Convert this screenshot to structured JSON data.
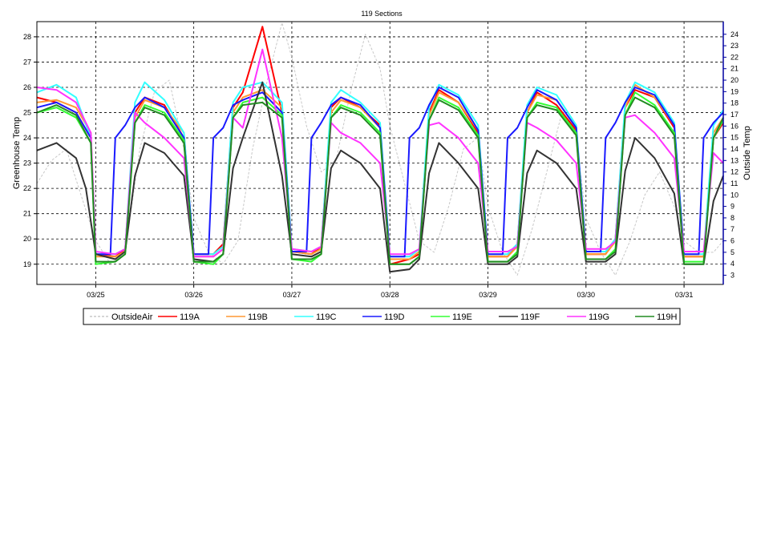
{
  "chart_data": {
    "type": "line",
    "title": "119 Sections",
    "ylabel": "Greenhouse Temp",
    "y2label": "Outside Temp",
    "x_ticks": [
      "03/25",
      "03/26",
      "03/27",
      "03/28",
      "03/29",
      "03/30",
      "03/31"
    ],
    "x_range_days": [
      -0.6,
      6.4
    ],
    "ylim": [
      18.2,
      28.6
    ],
    "y_ticks": [
      19,
      20,
      21,
      22,
      23,
      24,
      25,
      26,
      27,
      28
    ],
    "y2lim": [
      2.2,
      25.1
    ],
    "y2_ticks": [
      3,
      4,
      5,
      6,
      7,
      8,
      9,
      10,
      11,
      12,
      13,
      14,
      15,
      16,
      17,
      18,
      19,
      20,
      21,
      22,
      23,
      24
    ],
    "grid": true,
    "legend_position": "bottom",
    "series": [
      {
        "name": "OutsideAir",
        "axis": "right",
        "color": "#c8c8c8",
        "style": "dashed",
        "x": [
          -0.6,
          -0.45,
          -0.3,
          -0.15,
          0.0,
          0.15,
          0.3,
          0.45,
          0.6,
          0.75,
          0.9,
          1.0,
          1.15,
          1.3,
          1.45,
          1.6,
          1.75,
          1.9,
          2.0,
          2.15,
          2.3,
          2.45,
          2.6,
          2.75,
          2.9,
          3.0,
          3.15,
          3.3,
          3.45,
          3.6,
          3.75,
          3.9,
          4.0,
          4.15,
          4.3,
          4.45,
          4.6,
          4.75,
          4.9,
          5.0,
          5.15,
          5.3,
          5.45,
          5.6,
          5.75,
          5.9,
          6.0,
          6.15,
          6.3,
          6.4
        ],
        "y": [
          11,
          13,
          14,
          10,
          6,
          4,
          5,
          14,
          19,
          20,
          14,
          8,
          5,
          4,
          6,
          14,
          20,
          25,
          22,
          16,
          12,
          13,
          19,
          24,
          21,
          16,
          11,
          6,
          5,
          9,
          14,
          15,
          9,
          5,
          3,
          7,
          12,
          17,
          15,
          8,
          5,
          3,
          6,
          10,
          12,
          9,
          6,
          5,
          5,
          6
        ]
      },
      {
        "name": "119A",
        "axis": "left",
        "color": "#ff0000",
        "style": "solid",
        "x": [
          -0.6,
          -0.4,
          -0.2,
          -0.05,
          0.0,
          0.2,
          0.3,
          0.4,
          0.5,
          0.7,
          0.9,
          1.0,
          1.2,
          1.3,
          1.4,
          1.5,
          1.7,
          1.9,
          2.0,
          2.2,
          2.3,
          2.4,
          2.5,
          2.7,
          2.9,
          3.0,
          3.2,
          3.3,
          3.4,
          3.5,
          3.7,
          3.9,
          4.0,
          4.2,
          4.3,
          4.4,
          4.5,
          4.7,
          4.9,
          5.0,
          5.2,
          5.3,
          5.4,
          5.5,
          5.7,
          5.9,
          6.0,
          6.2,
          6.3,
          6.4
        ],
        "y": [
          25.6,
          25.4,
          25.0,
          24.0,
          19.4,
          19.3,
          19.6,
          25.0,
          25.6,
          25.3,
          24.0,
          19.4,
          19.4,
          19.8,
          25.2,
          25.8,
          28.4,
          25.0,
          19.5,
          19.4,
          19.7,
          25.2,
          25.6,
          25.2,
          24.5,
          19.0,
          19.2,
          19.4,
          25.0,
          25.9,
          25.4,
          24.2,
          19.3,
          19.3,
          19.8,
          25.0,
          25.8,
          25.3,
          24.3,
          19.4,
          19.4,
          20.0,
          25.2,
          25.9,
          25.6,
          24.4,
          19.3,
          19.3,
          24.0,
          24.6
        ]
      },
      {
        "name": "119B",
        "axis": "left",
        "color": "#ff9933",
        "style": "solid",
        "x": [
          -0.6,
          -0.4,
          -0.2,
          -0.05,
          0.0,
          0.2,
          0.3,
          0.4,
          0.5,
          0.7,
          0.9,
          1.0,
          1.2,
          1.3,
          1.4,
          1.5,
          1.7,
          1.9,
          2.0,
          2.2,
          2.3,
          2.4,
          2.5,
          2.7,
          2.9,
          3.0,
          3.2,
          3.3,
          3.4,
          3.5,
          3.7,
          3.9,
          4.0,
          4.2,
          4.3,
          4.4,
          4.5,
          4.7,
          4.9,
          5.0,
          5.2,
          5.3,
          5.4,
          5.5,
          5.7,
          5.9,
          6.0,
          6.2,
          6.3,
          6.4
        ],
        "y": [
          25.4,
          25.5,
          25.2,
          24.2,
          19.3,
          19.3,
          19.5,
          24.8,
          25.5,
          25.2,
          24.2,
          19.3,
          19.3,
          19.6,
          25.0,
          25.6,
          25.9,
          25.2,
          19.5,
          19.4,
          19.6,
          25.0,
          25.5,
          25.2,
          24.4,
          19.2,
          19.2,
          19.5,
          24.9,
          25.8,
          25.4,
          24.3,
          19.3,
          19.3,
          19.7,
          25.0,
          25.7,
          25.5,
          24.4,
          19.4,
          19.4,
          19.9,
          25.2,
          26.1,
          25.6,
          24.5,
          19.3,
          19.3,
          24.2,
          24.8
        ]
      },
      {
        "name": "119C",
        "axis": "left",
        "color": "#33ffff",
        "style": "solid",
        "x": [
          -0.6,
          -0.4,
          -0.2,
          -0.05,
          0.0,
          0.2,
          0.3,
          0.4,
          0.5,
          0.7,
          0.9,
          1.0,
          1.2,
          1.3,
          1.4,
          1.5,
          1.7,
          1.9,
          2.0,
          2.2,
          2.3,
          2.4,
          2.5,
          2.7,
          2.9,
          3.0,
          3.2,
          3.3,
          3.4,
          3.5,
          3.7,
          3.9,
          4.0,
          4.2,
          4.3,
          4.4,
          4.5,
          4.7,
          4.9,
          5.0,
          5.2,
          5.3,
          5.4,
          5.5,
          5.7,
          5.9,
          6.0,
          6.2,
          6.3,
          6.4
        ],
        "y": [
          25.8,
          26.1,
          25.6,
          24.0,
          19.4,
          19.4,
          19.6,
          25.4,
          26.2,
          25.5,
          24.2,
          19.4,
          19.4,
          19.7,
          25.4,
          26.0,
          26.2,
          25.4,
          19.6,
          19.5,
          19.7,
          25.4,
          25.9,
          25.4,
          24.6,
          19.3,
          19.3,
          19.6,
          25.2,
          26.1,
          25.7,
          24.5,
          19.4,
          19.4,
          19.8,
          25.3,
          26.0,
          25.7,
          24.5,
          19.5,
          19.5,
          20.0,
          25.4,
          26.2,
          25.8,
          24.6,
          19.4,
          19.4,
          24.5,
          25.1
        ]
      },
      {
        "name": "119D",
        "axis": "left",
        "color": "#1a1aff",
        "style": "solid",
        "x": [
          -0.6,
          -0.4,
          -0.2,
          -0.05,
          0.0,
          0.15,
          0.2,
          0.3,
          0.4,
          0.5,
          0.7,
          0.9,
          1.0,
          1.15,
          1.2,
          1.3,
          1.4,
          1.5,
          1.7,
          1.9,
          2.0,
          2.15,
          2.2,
          2.3,
          2.4,
          2.5,
          2.7,
          2.9,
          3.0,
          3.15,
          3.2,
          3.3,
          3.4,
          3.5,
          3.7,
          3.9,
          4.0,
          4.15,
          4.2,
          4.3,
          4.4,
          4.5,
          4.7,
          4.9,
          5.0,
          5.15,
          5.2,
          5.3,
          5.4,
          5.5,
          5.7,
          5.9,
          6.0,
          6.15,
          6.2,
          6.3,
          6.4
        ],
        "y": [
          25.2,
          25.4,
          25.0,
          24.0,
          19.4,
          19.4,
          24.0,
          24.5,
          25.2,
          25.6,
          25.2,
          24.0,
          19.4,
          19.4,
          24.0,
          24.4,
          25.3,
          25.5,
          25.8,
          25.0,
          19.5,
          19.5,
          24.0,
          24.6,
          25.3,
          25.6,
          25.3,
          24.4,
          19.3,
          19.3,
          24.0,
          24.4,
          25.3,
          26.0,
          25.6,
          24.3,
          19.4,
          19.4,
          24.0,
          24.4,
          25.2,
          25.9,
          25.5,
          24.4,
          19.5,
          19.5,
          24.0,
          24.6,
          25.4,
          26.0,
          25.7,
          24.5,
          19.4,
          19.4,
          24.0,
          24.6,
          25.0
        ]
      },
      {
        "name": "119E",
        "axis": "left",
        "color": "#33ff33",
        "style": "solid",
        "x": [
          -0.6,
          -0.4,
          -0.2,
          -0.05,
          0.0,
          0.2,
          0.3,
          0.4,
          0.5,
          0.7,
          0.9,
          1.0,
          1.2,
          1.3,
          1.4,
          1.5,
          1.7,
          1.9,
          2.0,
          2.2,
          2.3,
          2.4,
          2.5,
          2.7,
          2.9,
          3.0,
          3.2,
          3.3,
          3.4,
          3.5,
          3.7,
          3.9,
          4.0,
          4.2,
          4.3,
          4.4,
          4.5,
          4.7,
          4.9,
          5.0,
          5.2,
          5.3,
          5.4,
          5.5,
          5.7,
          5.9,
          6.0,
          6.2,
          6.3,
          6.4
        ],
        "y": [
          25.0,
          25.2,
          24.8,
          23.8,
          19.0,
          19.1,
          19.4,
          24.6,
          25.3,
          25.0,
          23.9,
          19.1,
          19.0,
          19.4,
          24.8,
          25.4,
          25.6,
          24.9,
          19.2,
          19.1,
          19.4,
          24.8,
          25.3,
          25.0,
          24.2,
          19.0,
          19.0,
          19.3,
          24.7,
          25.6,
          25.2,
          24.1,
          19.1,
          19.1,
          19.5,
          24.8,
          25.4,
          25.2,
          24.2,
          19.2,
          19.2,
          19.6,
          24.9,
          25.8,
          25.3,
          24.2,
          19.1,
          19.1,
          24.0,
          24.7
        ]
      },
      {
        "name": "119F",
        "axis": "left",
        "color": "#333333",
        "style": "solid",
        "x": [
          -0.6,
          -0.4,
          -0.2,
          -0.1,
          0.0,
          0.2,
          0.3,
          0.4,
          0.5,
          0.7,
          0.9,
          1.0,
          1.2,
          1.3,
          1.4,
          1.5,
          1.7,
          1.9,
          2.0,
          2.2,
          2.3,
          2.4,
          2.5,
          2.7,
          2.9,
          3.0,
          3.2,
          3.3,
          3.4,
          3.5,
          3.7,
          3.9,
          4.0,
          4.2,
          4.3,
          4.4,
          4.5,
          4.7,
          4.9,
          5.0,
          5.2,
          5.3,
          5.4,
          5.5,
          5.7,
          5.9,
          6.0,
          6.2,
          6.3,
          6.4
        ],
        "y": [
          23.5,
          23.8,
          23.2,
          22.0,
          19.4,
          19.2,
          19.5,
          22.5,
          23.8,
          23.4,
          22.5,
          19.2,
          19.1,
          19.4,
          22.8,
          24.0,
          26.2,
          22.5,
          19.4,
          19.3,
          19.5,
          22.8,
          23.5,
          23.0,
          22.0,
          18.7,
          18.8,
          19.2,
          22.6,
          23.8,
          23.0,
          22.0,
          19.0,
          19.0,
          19.3,
          22.6,
          23.5,
          23.0,
          22.0,
          19.1,
          19.1,
          19.4,
          22.7,
          24.0,
          23.2,
          21.8,
          19.0,
          19.0,
          21.5,
          22.5
        ]
      },
      {
        "name": "119G",
        "axis": "left",
        "color": "#ff33ff",
        "style": "solid",
        "x": [
          -0.6,
          -0.4,
          -0.2,
          -0.05,
          0.0,
          0.2,
          0.3,
          0.4,
          0.5,
          0.7,
          0.9,
          1.0,
          1.2,
          1.3,
          1.4,
          1.5,
          1.7,
          1.9,
          2.0,
          2.2,
          2.3,
          2.4,
          2.5,
          2.7,
          2.9,
          3.0,
          3.2,
          3.3,
          3.4,
          3.5,
          3.7,
          3.9,
          4.0,
          4.2,
          4.3,
          4.4,
          4.5,
          4.7,
          4.9,
          5.0,
          5.2,
          5.3,
          5.4,
          5.5,
          5.7,
          5.9,
          6.0,
          6.2,
          6.3,
          6.4
        ],
        "y": [
          26.0,
          25.9,
          25.4,
          24.2,
          19.5,
          19.4,
          19.6,
          25.0,
          24.6,
          24.0,
          23.2,
          19.3,
          19.3,
          19.6,
          24.8,
          24.4,
          27.5,
          24.0,
          19.6,
          19.5,
          19.7,
          24.6,
          24.2,
          23.8,
          23.0,
          19.4,
          19.4,
          19.6,
          24.5,
          24.6,
          24.0,
          23.0,
          19.5,
          19.5,
          19.7,
          24.6,
          24.4,
          23.9,
          23.0,
          19.6,
          19.6,
          19.9,
          24.8,
          24.9,
          24.2,
          23.2,
          19.5,
          19.5,
          23.4,
          23.0
        ]
      },
      {
        "name": "119H",
        "axis": "left",
        "color": "#228b22",
        "style": "solid",
        "x": [
          -0.6,
          -0.4,
          -0.2,
          -0.05,
          0.0,
          0.2,
          0.3,
          0.4,
          0.5,
          0.7,
          0.9,
          1.0,
          1.2,
          1.3,
          1.4,
          1.5,
          1.7,
          1.9,
          2.0,
          2.2,
          2.3,
          2.4,
          2.5,
          2.7,
          2.9,
          3.0,
          3.2,
          3.3,
          3.4,
          3.5,
          3.7,
          3.9,
          4.0,
          4.2,
          4.3,
          4.4,
          4.5,
          4.7,
          4.9,
          5.0,
          5.2,
          5.3,
          5.4,
          5.5,
          5.7,
          5.9,
          6.0,
          6.2,
          6.3,
          6.4
        ],
        "y": [
          25.0,
          25.3,
          24.9,
          23.8,
          19.1,
          19.1,
          19.4,
          24.6,
          25.2,
          24.9,
          23.8,
          19.1,
          19.1,
          19.4,
          24.8,
          25.3,
          25.4,
          24.8,
          19.2,
          19.2,
          19.4,
          24.8,
          25.2,
          24.9,
          24.1,
          19.0,
          19.0,
          19.3,
          24.7,
          25.5,
          25.1,
          24.0,
          19.1,
          19.1,
          19.4,
          24.8,
          25.3,
          25.1,
          24.1,
          19.2,
          19.2,
          19.5,
          24.9,
          25.6,
          25.2,
          24.1,
          19.0,
          19.0,
          24.0,
          24.8
        ]
      }
    ]
  }
}
